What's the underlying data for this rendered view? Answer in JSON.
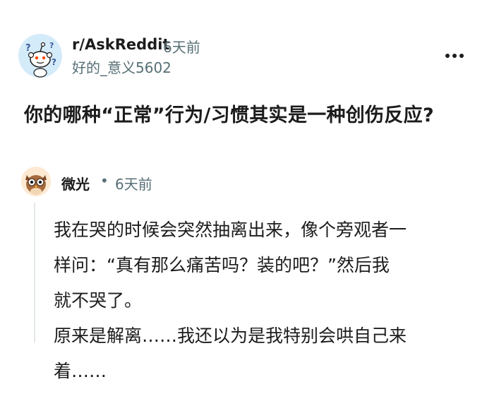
{
  "post": {
    "subreddit": "r/AskReddit",
    "time": "6天前",
    "author": "好的_意义5602",
    "title": "你的哪种“正常”行为/习惯其实是一种创伤反应?"
  },
  "comment": {
    "author": "微光",
    "separator": "•",
    "time": "6天前",
    "lines": [
      "我在哭的时候会突然抽离出来，像个旁观者一",
      "样问：“真有那么痛苦吗？装的吧？”然后我",
      "就不哭了。",
      "原来是解离……我还以为是我特别会哄自己来",
      "着……"
    ]
  },
  "colors": {
    "text": "#1c1c1c",
    "meta": "#576f76",
    "thread_line": "#e3e6e8",
    "subreddit_avatar_bg": "#d4ebfa"
  },
  "icons": {
    "subreddit_avatar": "askreddit-snoo-icon",
    "menu": "more-options-icon",
    "comment_avatar": "owl-avatar-icon"
  }
}
